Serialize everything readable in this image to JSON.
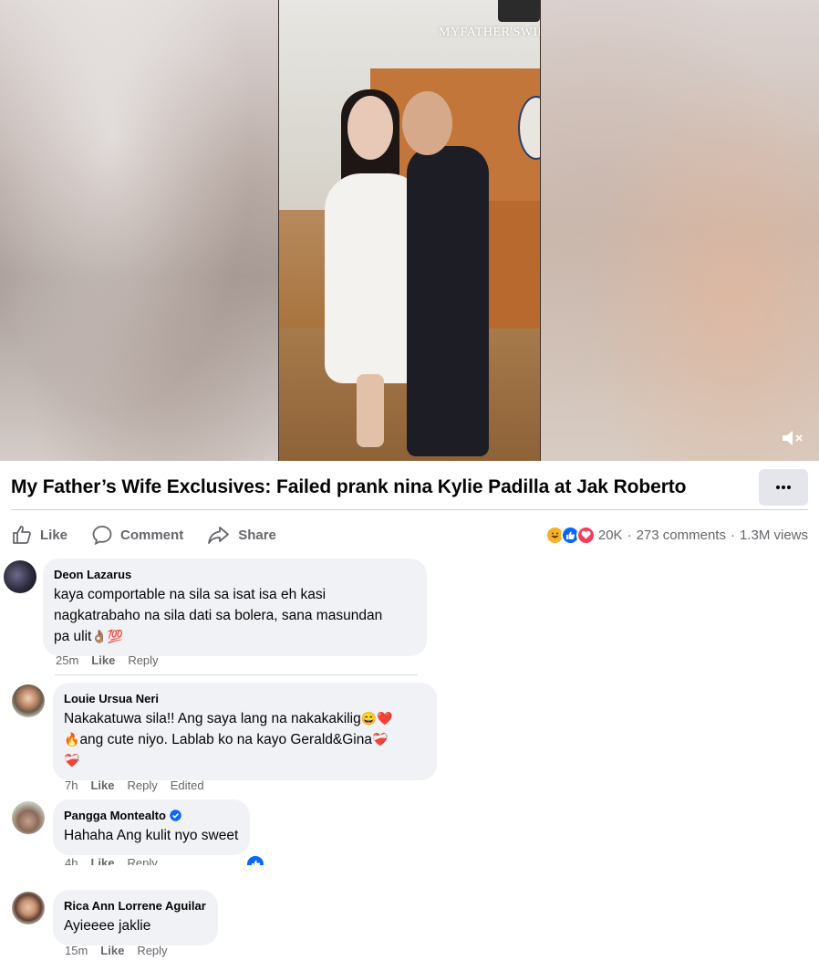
{
  "video": {
    "watermark": "MYFATHER'SWIFE",
    "mute_icon": "speaker-muted-icon"
  },
  "post": {
    "title": "My Father’s Wife Exclusives: Failed prank nina Kylie Padilla at Jak Roberto",
    "more_label": "···"
  },
  "actions": {
    "like": "Like",
    "comment": "Comment",
    "share": "Share"
  },
  "stats": {
    "reactions_count": "20K",
    "comments": "273 comments",
    "views": "1.3M views",
    "separator": "·"
  },
  "comments": [
    {
      "name": "Deon Lazarus",
      "text_line1": "kaya comportable na sila sa isat isa eh kasi",
      "text_line2": "nagkatrabaho na sila dati sa bolera, sana masundan",
      "text_line3": "pa ulit",
      "emoji3": "👌🏽💯",
      "time": "25m",
      "like": "Like",
      "reply": "Reply"
    },
    {
      "name": "Louie Ursua Neri",
      "text_line1": "Nakakatuwa sila!! Ang saya lang na nakakakilig",
      "emoji1": "😄❤️",
      "text_line2": "ang cute niyo. Lablab ko na kayo Gerald&Gina",
      "emoji2a": "🔥",
      "emoji2b": "❤️‍🩹",
      "emoji3": "❤️‍🩹",
      "time": "7h",
      "like": "Like",
      "reply": "Reply",
      "edited": "Edited"
    },
    {
      "name": "Pangga Montealto",
      "text": "Hahaha Ang kulit nyo sweet",
      "time": "4h",
      "like": "Like",
      "reply": "Reply"
    },
    {
      "name": "Rica Ann Lorrene Aguilar",
      "text": "Ayieeee jaklie",
      "time": "15m",
      "like": "Like",
      "reply": "Reply"
    }
  ],
  "colors": {
    "meta_gray": "#65676b",
    "bubble_bg": "#f0f2f5",
    "verified_blue": "#0866ff",
    "like_blue": "#0866ff",
    "love_red": "#f33e58",
    "haha_yellow": "#f7b125"
  }
}
